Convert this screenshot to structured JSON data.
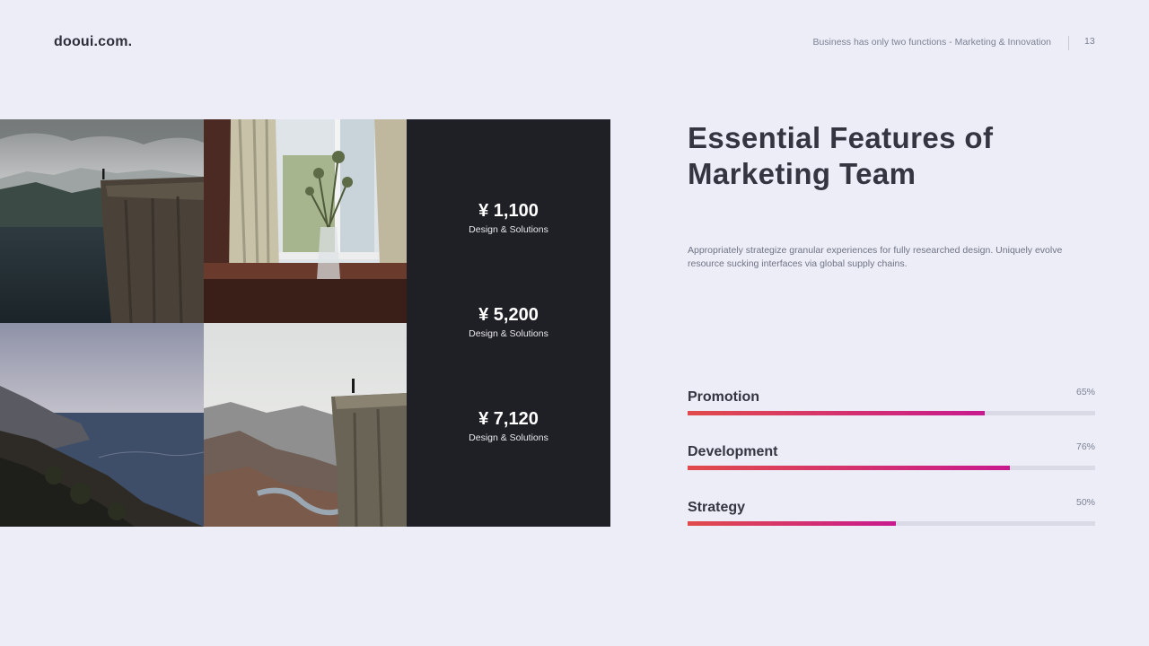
{
  "header": {
    "logo": "dooui.com.",
    "tagline": "Business has only two functions - Marketing & Innovation",
    "page_number": "13"
  },
  "photos": [
    {
      "name": "cliff-over-fjord-photo"
    },
    {
      "name": "window-vase-photo"
    },
    {
      "name": "coastal-cliffs-photo"
    },
    {
      "name": "person-on-cliff-photo"
    }
  ],
  "prices": [
    {
      "value": "¥ 1,100",
      "label": "Design & Solutions"
    },
    {
      "value": "¥ 5,200",
      "label": "Design & Solutions"
    },
    {
      "value": "¥ 7,120",
      "label": "Design & Solutions"
    }
  ],
  "title": "Essential Features of Marketing Team",
  "description": "Appropriately strategize granular experiences for fully researched design. Uniquely evolve resource sucking interfaces via global supply chains.",
  "metrics": [
    {
      "label": "Promotion",
      "percent": "65%",
      "value": 0.73
    },
    {
      "label": "Development",
      "percent": "76%",
      "value": 0.79
    },
    {
      "label": "Strategy",
      "percent": "50%",
      "value": 0.51
    }
  ],
  "colors": {
    "background": "#ECEDF6",
    "panel": "#1F2026",
    "bar_start": "#E14B4B",
    "bar_end": "#C81A8E",
    "track": "#D9DAE5"
  }
}
